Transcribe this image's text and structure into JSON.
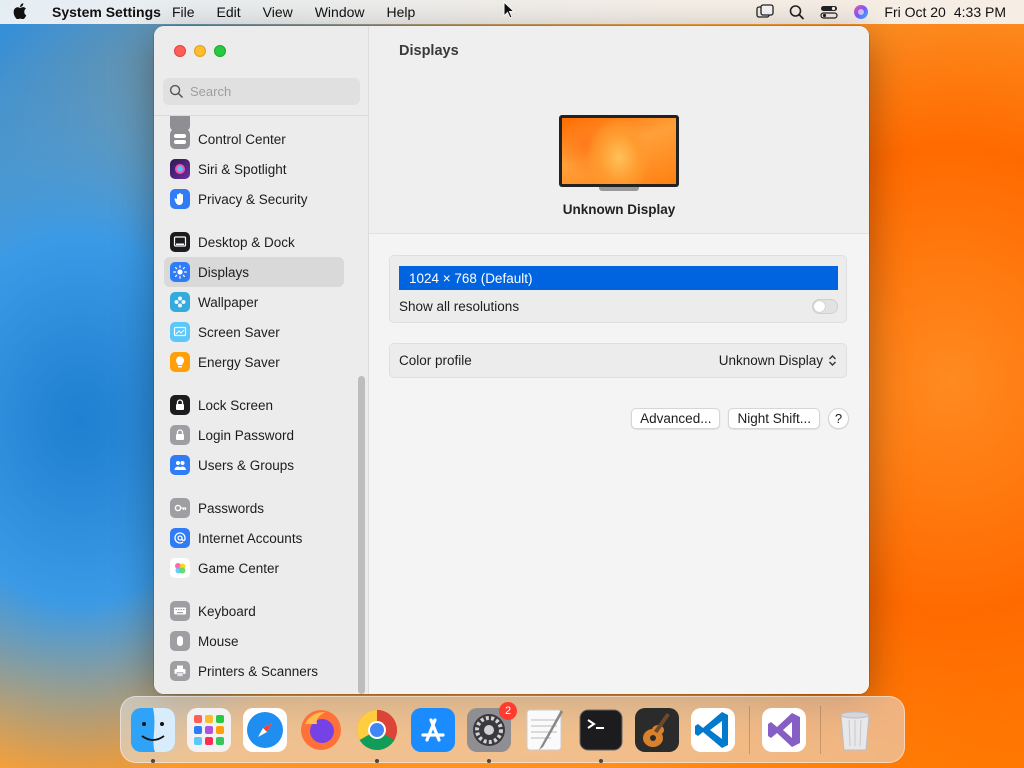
{
  "menubar": {
    "app_name": "System Settings",
    "menus": [
      "File",
      "Edit",
      "View",
      "Window",
      "Help"
    ],
    "date": "Fri Oct 20",
    "time": "4:33 PM"
  },
  "sidebar": {
    "search_placeholder": "Search",
    "items": [
      {
        "label": "Control Center",
        "icon": "control-center-icon",
        "color": "#8e8e93"
      },
      {
        "label": "Siri & Spotlight",
        "icon": "siri-icon",
        "color": "#5b2b8f"
      },
      {
        "label": "Privacy & Security",
        "icon": "hand-icon",
        "color": "#2f7cf6"
      },
      {
        "label": "Desktop & Dock",
        "icon": "dock-icon",
        "color": "#1c1c1e"
      },
      {
        "label": "Displays",
        "icon": "sun-icon",
        "color": "#2f7cf6",
        "selected": true
      },
      {
        "label": "Wallpaper",
        "icon": "flower-icon",
        "color": "#35aadc"
      },
      {
        "label": "Screen Saver",
        "icon": "screensaver-icon",
        "color": "#5ac8fa"
      },
      {
        "label": "Energy Saver",
        "icon": "bulb-icon",
        "color": "#ff9f0a"
      },
      {
        "label": "Lock Screen",
        "icon": "lock-icon",
        "color": "#1c1c1e"
      },
      {
        "label": "Login Password",
        "icon": "padlock-icon",
        "color": "#8e8e93"
      },
      {
        "label": "Users & Groups",
        "icon": "users-icon",
        "color": "#2f7cf6"
      },
      {
        "label": "Passwords",
        "icon": "key-icon",
        "color": "#8e8e93"
      },
      {
        "label": "Internet Accounts",
        "icon": "at-icon",
        "color": "#2f7cf6"
      },
      {
        "label": "Game Center",
        "icon": "game-center-icon",
        "color": "#ffffff"
      },
      {
        "label": "Keyboard",
        "icon": "keyboard-icon",
        "color": "#8e8e93"
      },
      {
        "label": "Mouse",
        "icon": "mouse-icon",
        "color": "#8e8e93"
      },
      {
        "label": "Printers & Scanners",
        "icon": "printer-icon",
        "color": "#8e8e93"
      }
    ]
  },
  "main": {
    "title": "Displays",
    "display_name": "Unknown Display",
    "resolution_selected": "1024 × 768 (Default)",
    "show_all_resolutions_label": "Show all resolutions",
    "show_all_resolutions_on": false,
    "color_profile_label": "Color profile",
    "color_profile_value": "Unknown Display",
    "advanced_button": "Advanced...",
    "night_shift_button": "Night Shift...",
    "help_button": "?"
  },
  "dock": {
    "apps": [
      {
        "name": "Finder",
        "icon": "finder-icon",
        "running": true
      },
      {
        "name": "Launchpad",
        "icon": "launchpad-icon",
        "running": false
      },
      {
        "name": "Safari",
        "icon": "safari-icon",
        "running": false
      },
      {
        "name": "Firefox",
        "icon": "firefox-icon",
        "running": false
      },
      {
        "name": "Chrome",
        "icon": "chrome-icon",
        "running": true
      },
      {
        "name": "App Store",
        "icon": "app-store-icon",
        "running": false
      },
      {
        "name": "System Settings",
        "icon": "system-settings-icon",
        "running": true,
        "badge": "2"
      },
      {
        "name": "TextEdit",
        "icon": "textedit-icon",
        "running": false
      },
      {
        "name": "Terminal",
        "icon": "terminal-icon",
        "running": true
      },
      {
        "name": "GarageBand",
        "icon": "garageband-icon",
        "running": false
      },
      {
        "name": "VS Code",
        "icon": "vscode-icon",
        "running": false
      },
      {
        "name": "Visual Studio",
        "icon": "visual-studio-icon",
        "running": false
      },
      {
        "name": "Trash",
        "icon": "trash-icon",
        "running": false
      }
    ]
  }
}
